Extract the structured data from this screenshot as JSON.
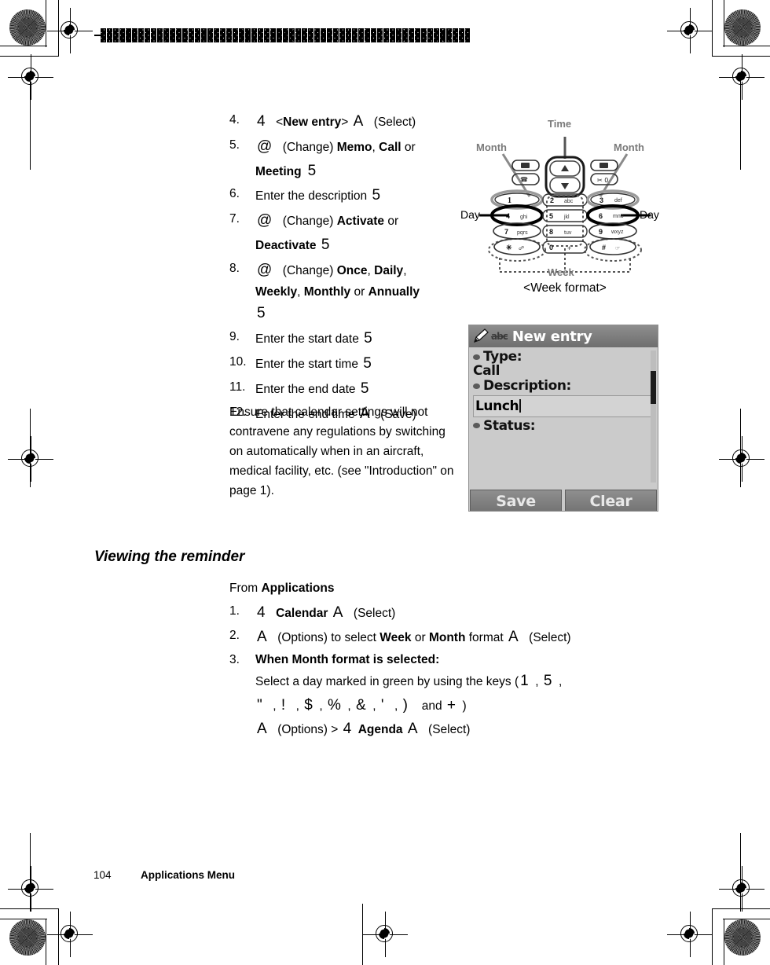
{
  "page": {
    "footer_page_number": "104",
    "footer_title": "Applications Menu"
  },
  "steps_create": [
    {
      "num": "4.",
      "html_id": "s4"
    },
    {
      "num": "5.",
      "html_id": "s5"
    },
    {
      "num": "6.",
      "html_id": "s6"
    },
    {
      "num": "7.",
      "html_id": "s7"
    },
    {
      "num": "8.",
      "html_id": "s8"
    },
    {
      "num": "9.",
      "html_id": "s9"
    },
    {
      "num": "10.",
      "html_id": "s10"
    },
    {
      "num": "11.",
      "html_id": "s11"
    },
    {
      "num": "12.",
      "html_id": "s12"
    }
  ],
  "step4": {
    "key_nav": "4",
    "lt": "<",
    "target": "New entry",
    "gt": ">",
    "key_select": "A",
    "action": "(Select)"
  },
  "step5": {
    "key_change": "@",
    "action": "(Change)",
    "opt1": "Memo",
    "sep1": ",",
    "opt2": "Call",
    "or": "or",
    "opt3": "Meeting",
    "key_ok": "5"
  },
  "step6": {
    "text": "Enter the description",
    "key_ok": "5"
  },
  "step7": {
    "key_change": "@",
    "action": "(Change)",
    "opt1": "Activate",
    "or": "or",
    "opt2": "Deactivate",
    "key_ok": "5"
  },
  "step8": {
    "key_change": "@",
    "action": "(Change)",
    "opt1": "Once",
    "opt2": "Daily",
    "opt3": "Weekly",
    "opt4": "Monthly",
    "or": "or",
    "opt5": "Annually",
    "key_ok": "5"
  },
  "step9": {
    "text": "Enter the start date",
    "key_ok": "5"
  },
  "step10": {
    "text": "Enter the start time",
    "key_ok": "5"
  },
  "step11": {
    "text": "Enter the end date",
    "key_ok": "5"
  },
  "step12": {
    "text": "Enter the end time",
    "key_save": "A",
    "action": "(Save)"
  },
  "note": {
    "text": "Ensure that calendar settings will not contravene any regulations by switching on automatically when in an aircraft, medical facility, etc. (see \"Introduction\" on page 1)."
  },
  "section": {
    "heading": "Viewing the reminder",
    "from_prefix": "From",
    "from_target": "Applications"
  },
  "steps_view": [
    {
      "num": "1."
    },
    {
      "num": "2."
    },
    {
      "num": "3."
    }
  ],
  "view1": {
    "key_nav": "4",
    "target": "Calendar",
    "key_select": "A",
    "action": "(Select)"
  },
  "view2": {
    "key_opts": "A",
    "action1": "(Options)",
    "mid": "to select",
    "opt1": "Week",
    "or": "or",
    "opt2": "Month",
    "fmt": "format",
    "key_select": "A",
    "action2": "(Select)"
  },
  "view3": {
    "bold_line": "When Month format is selected:",
    "sel_text": "Select a day marked in green by using the keys",
    "open_paren": "(",
    "keys_row1": [
      "1",
      "5"
    ],
    "keys_row2": [
      "\"",
      "!",
      "$",
      "%",
      "&",
      "'",
      ")"
    ],
    "and": "and",
    "key_last": "+",
    "close_paren": ")",
    "key_opts": "A",
    "action1": "(Options)",
    "arrow": ">",
    "key_nav": "4",
    "target": "Agenda",
    "key_select": "A",
    "action2": "(Select)"
  },
  "keypad_figure": {
    "label_time": "Time",
    "label_month_left": "Month",
    "label_month_right": "Month",
    "label_day_left": "Day",
    "label_day_right": "Day",
    "label_week": "Week",
    "caption": "<Week format>",
    "keys": [
      {
        "digit": "1",
        "letters": ""
      },
      {
        "digit": "2",
        "letters": "abc"
      },
      {
        "digit": "3",
        "letters": "def"
      },
      {
        "digit": "4",
        "letters": "ghi"
      },
      {
        "digit": "5",
        "letters": "jkl"
      },
      {
        "digit": "6",
        "letters": "mno"
      },
      {
        "digit": "7",
        "letters": "pqrs"
      },
      {
        "digit": "8",
        "letters": "tuv"
      },
      {
        "digit": "9",
        "letters": "wxyz"
      },
      {
        "digit": "*",
        "letters": ""
      },
      {
        "digit": "0",
        "letters": "+"
      },
      {
        "digit": "#",
        "letters": ""
      }
    ]
  },
  "lcd": {
    "title": "New entry",
    "input_mode": "abc",
    "pencil_icon": "pencil-icon",
    "rows": [
      {
        "label": "Type:",
        "value": "Call"
      },
      {
        "label": "Description:",
        "value": "Lunch"
      },
      {
        "label": "Status:",
        "value": ""
      }
    ],
    "field_value": "Lunch",
    "softkey_left": "Save",
    "softkey_right": "Clear"
  },
  "colors": {
    "lcd_bg": "#c9c9c9",
    "lcd_titlebar": "#7b7b7b",
    "lcd_text": "#111111",
    "label_gray": "#7a7a7a"
  }
}
